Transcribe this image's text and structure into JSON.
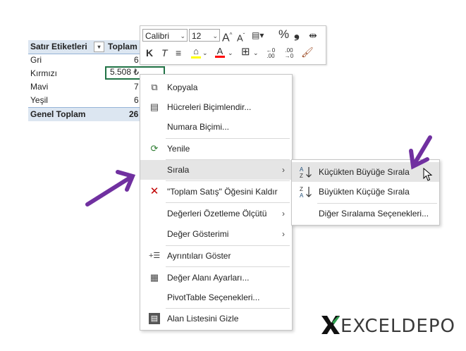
{
  "pivot": {
    "header_label": "Satır Etiketleri",
    "header_value": "Toplam",
    "rows": [
      {
        "label": "Gri",
        "value": "6"
      },
      {
        "label": "Kırmızı",
        "value": "5.508 ₺"
      },
      {
        "label": "Mavi",
        "value": "7"
      },
      {
        "label": "Yeşil",
        "value": "6"
      }
    ],
    "total_label": "Genel Toplam",
    "total_value": "26"
  },
  "toolbar": {
    "font_name": "Calibri",
    "font_size": "12",
    "bold": "K",
    "italic": "T",
    "percent": "%",
    "comma": "❟",
    "grow": "A",
    "shrink": "A",
    "dec_inc": ",0 .00",
    "dec_dec": ".00 ,0"
  },
  "menu": {
    "items": [
      {
        "label": "Kopyala",
        "icon": "copy-icon"
      },
      {
        "label": "Hücreleri Biçimlendir...",
        "icon": "format-cells-icon"
      },
      {
        "label": "Numara Biçimi..."
      },
      {
        "label": "Yenile",
        "icon": "refresh-icon"
      },
      {
        "label": "Sırala",
        "submenu": true
      },
      {
        "label": "\"Toplam Satış\" Öğesini Kaldır",
        "icon": "remove-x-icon"
      },
      {
        "label": "Değerleri Özetleme Ölçütü",
        "submenu": true
      },
      {
        "label": "Değer Gösterimi",
        "submenu": true
      },
      {
        "label": "Ayrıntıları Göster",
        "icon": "show-details-icon"
      },
      {
        "label": "Değer Alanı Ayarları...",
        "icon": "field-settings-icon"
      },
      {
        "label": "PivotTable Seçenekleri..."
      },
      {
        "label": "Alan Listesini Gizle",
        "icon": "field-list-icon"
      }
    ]
  },
  "submenu": {
    "items": [
      {
        "label": "Küçükten Büyüğe Sırala",
        "icon": "sort-asc-icon"
      },
      {
        "label": "Büyükten Küçüğe Sırala",
        "icon": "sort-desc-icon"
      },
      {
        "label": "Diğer Sıralama Seçenekleri..."
      }
    ]
  },
  "logo": {
    "text": "EXCELDEPO"
  },
  "colors": {
    "accent": "#7030a0",
    "excel_green": "#217346",
    "pivot_header": "#dce6f1"
  }
}
